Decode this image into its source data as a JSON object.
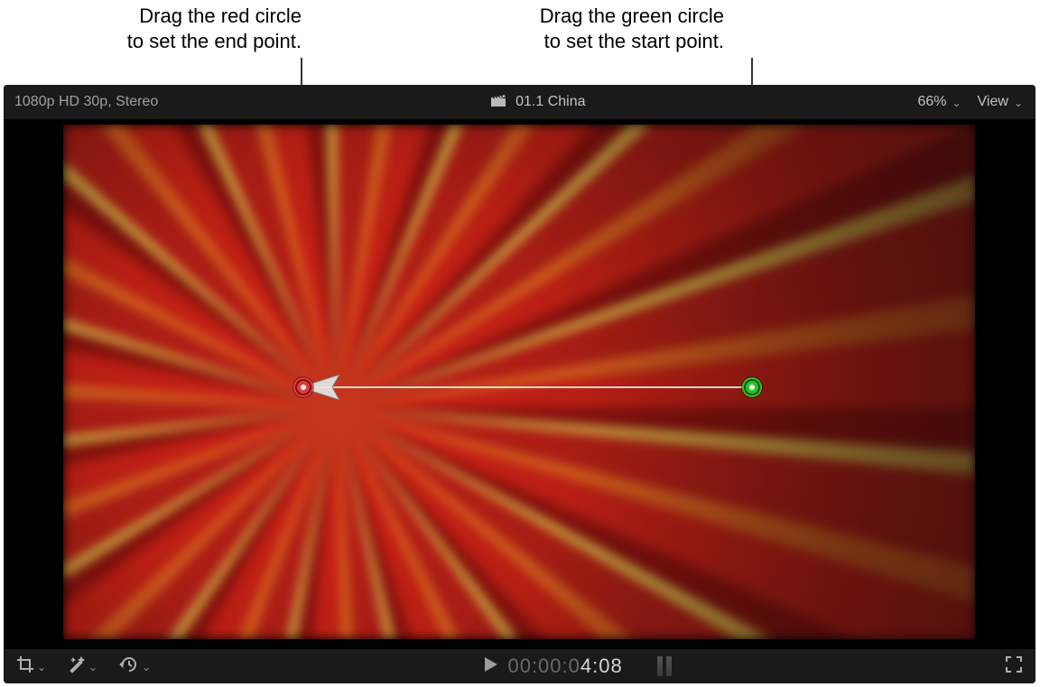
{
  "callouts": {
    "end": "Drag the red circle\nto set the end point.",
    "start": "Drag the green circle\nto set the start point."
  },
  "topbar": {
    "format": "1080p HD 30p, Stereo",
    "clip_title": "01.1 China",
    "zoom": "66%",
    "view_label": "View"
  },
  "transport": {
    "timecode_gray": "00:00:0",
    "timecode_hot": "4:08"
  },
  "icons": {
    "clapper": "clapper-icon",
    "crop": "crop-icon",
    "wand": "wand-icon",
    "retime": "retime-icon",
    "play": "play-icon",
    "fullscreen": "fullscreen-icon",
    "start_handle": "start-point-handle",
    "end_handle": "end-point-handle"
  }
}
